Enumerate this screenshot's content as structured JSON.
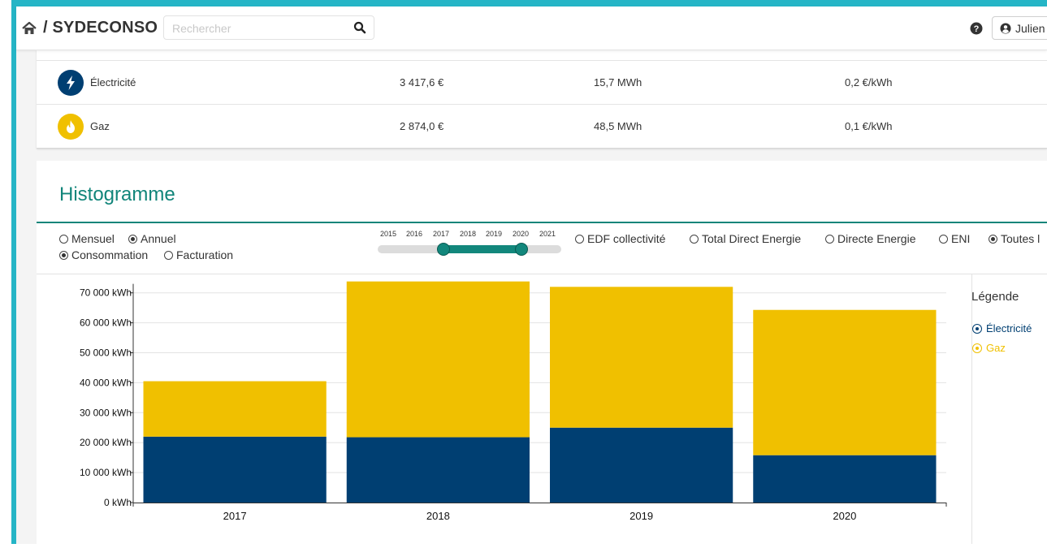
{
  "header": {
    "app_title": "/ SYDECONSO",
    "search_placeholder": "Rechercher",
    "user_name": "Julien"
  },
  "summary": {
    "rows": [
      {
        "label": "Électricité",
        "cost": "3 417,6 €",
        "consumption": "15,7 MWh",
        "unit_price": "0,2 €/kWh",
        "icon": "lightning-icon",
        "color": "#003f72"
      },
      {
        "label": "Gaz",
        "cost": "2 874,0 €",
        "consumption": "48,5 MWh",
        "unit_price": "0,1 €/kWh",
        "icon": "flame-icon",
        "color": "#f0c000"
      }
    ]
  },
  "histogram": {
    "title": "Histogramme",
    "period_options": [
      {
        "label": "Mensuel",
        "selected": false
      },
      {
        "label": "Annuel",
        "selected": true
      }
    ],
    "mode_options": [
      {
        "label": "Consommation",
        "selected": true
      },
      {
        "label": "Facturation",
        "selected": false
      }
    ],
    "slider": {
      "years": [
        "2015",
        "2016",
        "2017",
        "2018",
        "2019",
        "2020",
        "2021"
      ],
      "range": [
        "2017",
        "2020"
      ]
    },
    "supplier_options": [
      {
        "label": "EDF collectivité",
        "selected": false
      },
      {
        "label": "Total Direct Energie",
        "selected": false
      },
      {
        "label": "Directe Energie",
        "selected": false
      },
      {
        "label": "ENI",
        "selected": false
      },
      {
        "label": "Toutes l",
        "selected": true
      }
    ],
    "legend": {
      "title": "Légende",
      "items": [
        {
          "label": "Électricité",
          "color": "#003f72"
        },
        {
          "label": "Gaz",
          "color": "#f0c000"
        }
      ]
    }
  },
  "chart_data": {
    "type": "bar",
    "stacked": true,
    "categories": [
      "2017",
      "2018",
      "2019",
      "2020"
    ],
    "series": [
      {
        "name": "Électricité",
        "values": [
          22000,
          21800,
          25000,
          15800
        ],
        "color": "#003f72"
      },
      {
        "name": "Gaz",
        "values": [
          18500,
          52000,
          47000,
          48500
        ],
        "color": "#f0c000"
      }
    ],
    "y_ticks": [
      "0 kWh",
      "10 000 kWh",
      "20 000 kWh",
      "30 000 kWh",
      "40 000 kWh",
      "50 000 kWh",
      "60 000 kWh",
      "70 000 kWh"
    ],
    "ylim": [
      0,
      73000
    ],
    "grid": true,
    "legend_position": "right"
  }
}
